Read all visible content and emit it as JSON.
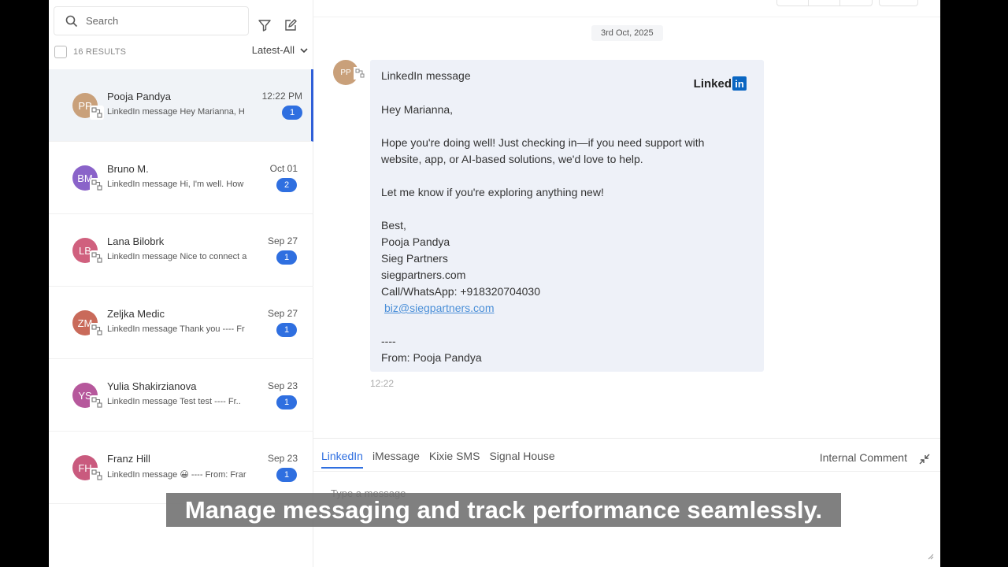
{
  "search": {
    "placeholder": "Search"
  },
  "filter": {
    "results": "16 RESULTS",
    "sort": "Latest-All"
  },
  "conversations": [
    {
      "initials": "PP",
      "name": "Pooja Pandya",
      "time": "12:22 PM",
      "preview": "LinkedIn message Hey Marianna,  H",
      "unread": "1",
      "color": "#c9a07a"
    },
    {
      "initials": "BM",
      "name": "Bruno M.",
      "time": "Oct 01",
      "preview": "LinkedIn message Hi, I'm well. How",
      "unread": "2",
      "color": "#8a63c9"
    },
    {
      "initials": "LB",
      "name": "Lana Bilobrk",
      "time": "Sep 27",
      "preview": "LinkedIn message Nice to connect a",
      "unread": "1",
      "color": "#d0607e"
    },
    {
      "initials": "ZM",
      "name": "Zeljka Medic",
      "time": "Sep 27",
      "preview": "LinkedIn message Thank you ---- Fr",
      "unread": "1",
      "color": "#c96a5a"
    },
    {
      "initials": "YS",
      "name": "Yulia Shakirzianova",
      "time": "Sep 23",
      "preview": "LinkedIn message Test test ---- Fr..",
      "unread": "1",
      "color": "#b6589c"
    },
    {
      "initials": "FH",
      "name": "Franz Hill",
      "time": "Sep 23",
      "preview": "LinkedIn message 😀 ---- From: Frar",
      "unread": "1",
      "color": "#c95a7e"
    }
  ],
  "thread": {
    "date": "3rd Oct, 2025",
    "sender_initials": "PP",
    "header": "LinkedIn message",
    "brand": "Linked",
    "brand_in": "in",
    "greeting": "Hey Marianna,",
    "body1": "Hope you're doing well! Just checking in—if you need support with",
    "body2": "website, app, or AI-based solutions, we'd love to help.",
    "body3": "Let me know if you're exploring anything new!",
    "sign_best": "Best,",
    "sign_name": "Pooja Pandya",
    "sign_company": "Sieg Partners",
    "sign_site": "siegpartners.com",
    "sign_phone": "Call/WhatsApp: +918320704030",
    "sign_email": "biz@siegpartners.com",
    "separator": "----",
    "from": "From: Pooja Pandya",
    "time": "12:22"
  },
  "composer": {
    "tabs": [
      "LinkedIn",
      "iMessage",
      "Kixie SMS",
      "Signal House"
    ],
    "internal": "Internal Comment",
    "placeholder": "Type a message"
  },
  "caption": "Manage messaging and track performance seamlessly."
}
